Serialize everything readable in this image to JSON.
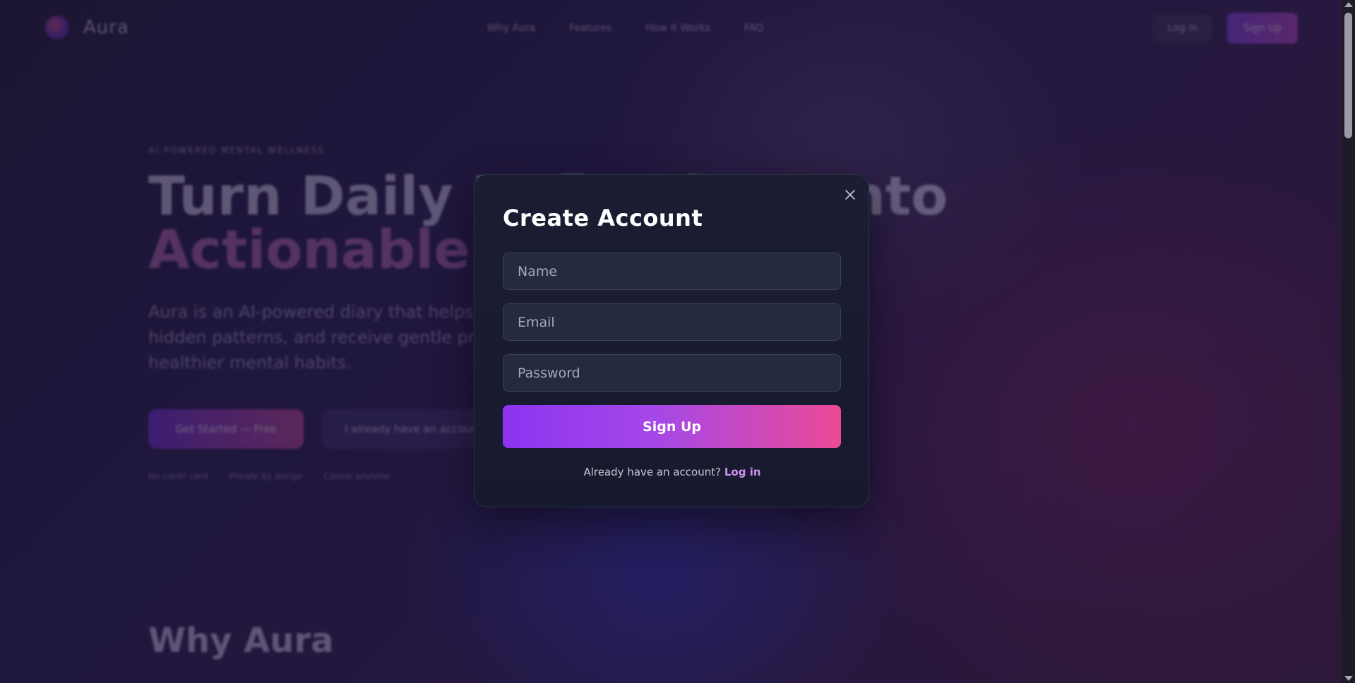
{
  "background": {
    "brand": "Aura",
    "nav_links": [
      "Why Aura",
      "Features",
      "How it Works",
      "FAQ"
    ],
    "nav_login": "Log in",
    "nav_signup": "Sign Up",
    "eyebrow": "AI-POWERED MENTAL WELLNESS",
    "hero_title_line1": "Turn Daily Reflections Into",
    "hero_title_line2": "Actionable Clarity",
    "hero_subtitle": "Aura is an AI-powered diary that helps you uncover hidden patterns, and receive gentle prompts toward healthier mental habits.",
    "cta_primary": "Get Started — Free",
    "cta_secondary": "I already have an account",
    "trust_items": [
      "No credit card",
      "Private by design",
      "Cancel anytime"
    ],
    "section_title": "Why Aura"
  },
  "modal": {
    "title": "Create Account",
    "name_placeholder": "Name",
    "email_placeholder": "Email",
    "password_placeholder": "Password",
    "submit_label": "Sign Up",
    "switch_text": "Already have an account?",
    "switch_link": "Log in"
  },
  "colors": {
    "accent_start": "#8b34f0",
    "accent_end": "#ec4a96",
    "link": "#d290f5",
    "modal_bg": "#1b1d33"
  }
}
